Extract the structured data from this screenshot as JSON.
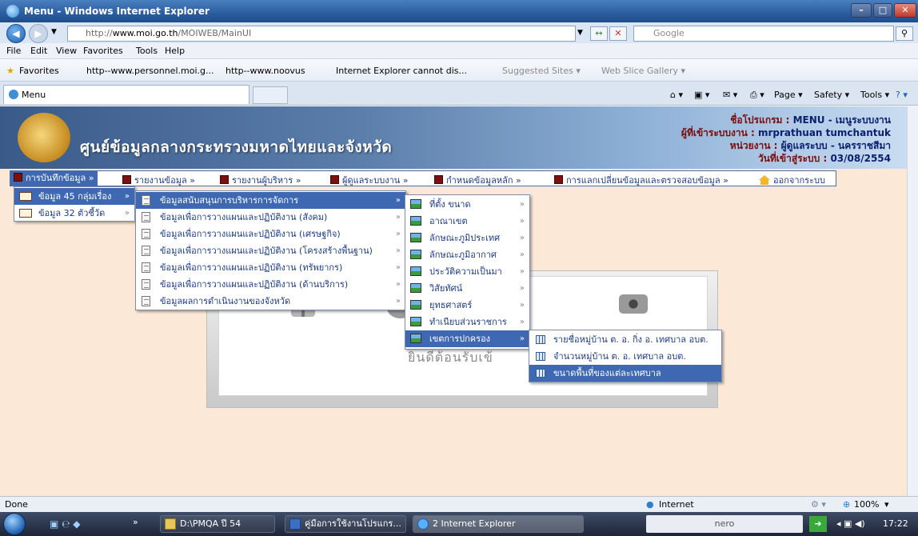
{
  "window": {
    "title": "Menu - Windows Internet Explorer",
    "url_prefix": "http://",
    "url_host": "www.moi.go.th",
    "url_path": "/MOIWEB/MainUI",
    "search_placeholder": "Google"
  },
  "menubar": [
    "File",
    "Edit",
    "View",
    "Favorites",
    "Tools",
    "Help"
  ],
  "favorites": {
    "label": "Favorites",
    "items": [
      "http--www.personnel.moi.g...",
      "http--www.noovus",
      "Internet Explorer cannot dis...",
      "Suggested Sites ▾",
      "Web Slice Gallery ▾"
    ]
  },
  "tab": {
    "title": "Menu"
  },
  "commandbar": {
    "page": "Page ▾",
    "safety": "Safety ▾",
    "tools": "Tools ▾"
  },
  "header": {
    "site_title": "ศูนย์ข้อมูลกลางกระทรวงมหาดไทยและจังหวัด",
    "program_label": "ชื่อโปรแกรม : ",
    "program_value": "MENU - เมนูระบบงาน",
    "user_label": "ผู้ที่เข้าระบบงาน : ",
    "user_value": "mrprathuan tumchantuk",
    "unit_label": "หน่วยงาน : ",
    "unit_value": "ผู้ดูแลระบบ - นครราชสีมา",
    "date_label": "วันที่เข้าสู่ระบบ : ",
    "date_value": "03/08/2554"
  },
  "nav": {
    "items": [
      "การบันทึกข้อมูล",
      "รายงานข้อมูล",
      "รายงานผู้บริหาร",
      "ผู้ดูแลระบบงาน",
      "กำหนดข้อมูลหลัก",
      "การแลกเปลี่ยนข้อมูลและตรวจสอบข้อมูล",
      "ออกจากระบบ"
    ]
  },
  "menu1": [
    "ข้อมูล 45 กลุ่มเรื่อง",
    "ข้อมูล 32 ตัวชี้วัด"
  ],
  "menu2": [
    "ข้อมูลสนับสนุนการบริหารการจัดการ",
    "ข้อมูลเพื่อการวางแผนและปฏิบัติงาน (สังคม)",
    "ข้อมูลเพื่อการวางแผนและปฏิบัติงาน (เศรษฐกิจ)",
    "ข้อมูลเพื่อการวางแผนและปฏิบัติงาน (โครงสร้างพื้นฐาน)",
    "ข้อมูลเพื่อการวางแผนและปฏิบัติงาน (ทรัพยากร)",
    "ข้อมูลเพื่อการวางแผนและปฏิบัติงาน (ด้านบริการ)",
    "ข้อมูลผลการดำเนินงานของจังหวัด"
  ],
  "menu3": [
    "ที่ตั้ง ขนาด",
    "อาณาเขต",
    "ลักษณะภูมิประเทศ",
    "ลักษณะภูมิอากาศ",
    "ประวัติความเป็นมา",
    "วิสัยทัศน์",
    "ยุทธศาสตร์",
    "ทำเนียบส่วนราชการ",
    "เขตการปกครอง"
  ],
  "menu4": [
    "รายชื่อหมู่บ้าน ต. อ. กิ่ง อ. เทศบาล อบต.",
    "จำนวนหมู่บ้าน ต. อ. เทศบาล อบต.",
    "ขนาดพื้นที่ของแต่ละเทศบาล"
  ],
  "welcome_text": "ยินดีต้อนรับเข้",
  "status": {
    "left": "Done",
    "zone": "Internet",
    "zoom": "100%"
  },
  "taskbar": {
    "items": [
      "D:\\PMQA ปี 54",
      "คู่มือการใช้งานโปรแกร...",
      "2 Internet Explorer"
    ],
    "nero": "nero",
    "clock": "17:22"
  }
}
